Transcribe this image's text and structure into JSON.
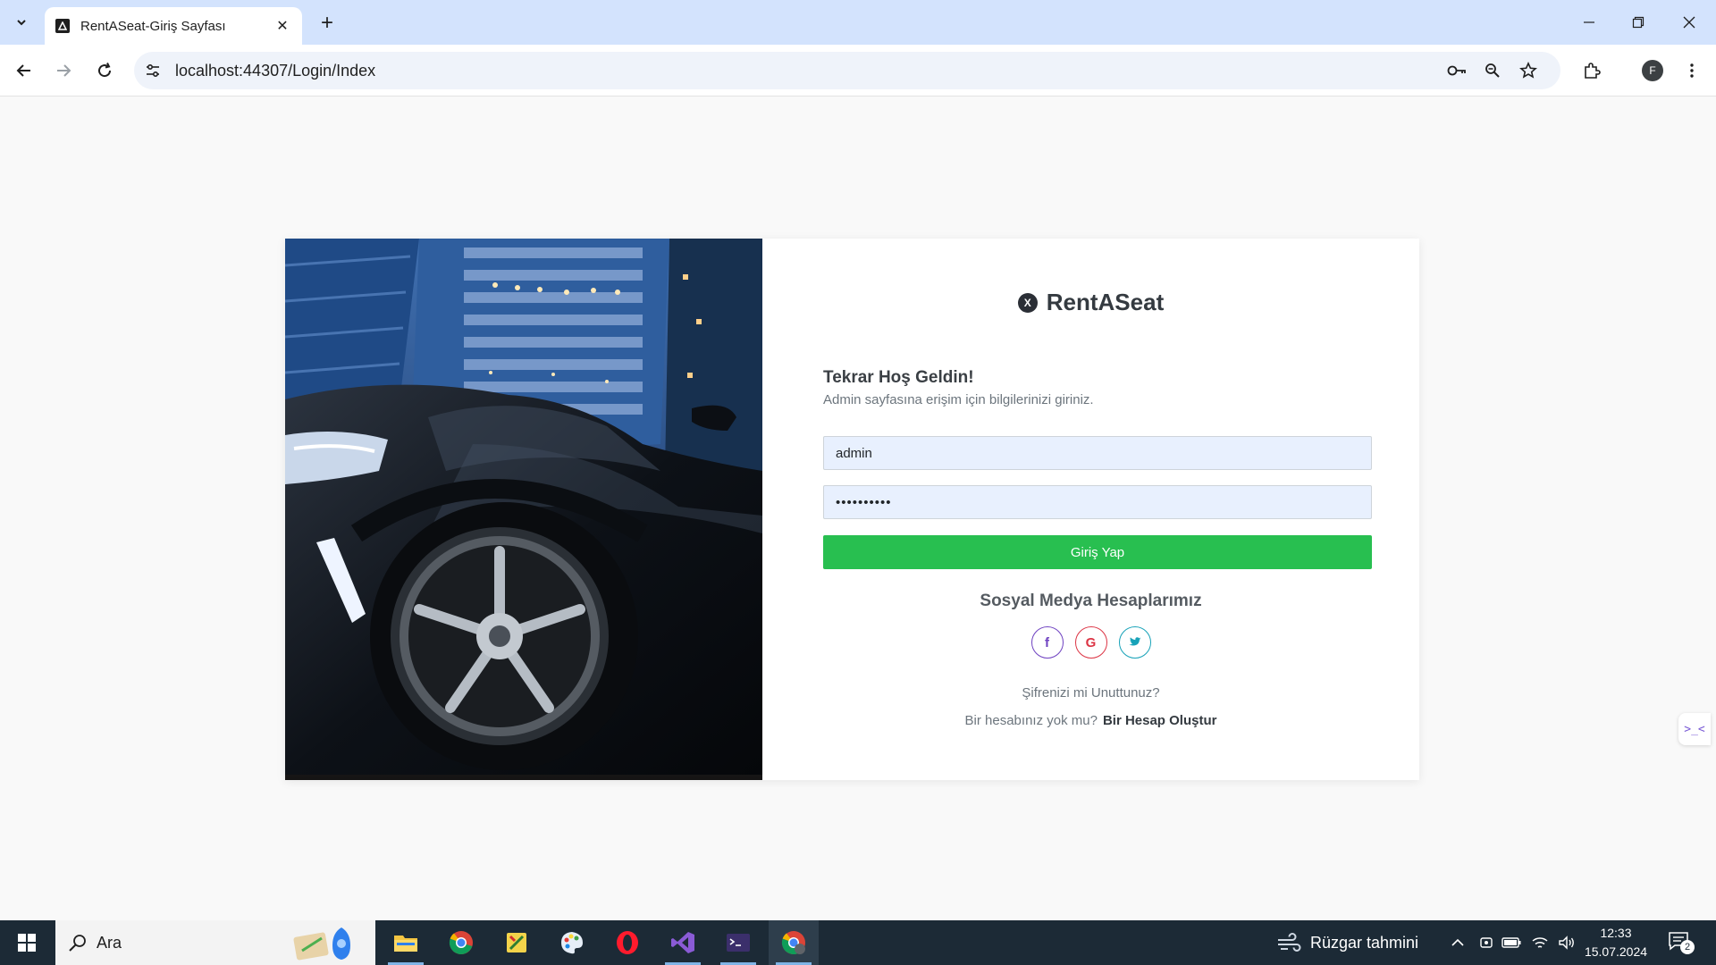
{
  "browser": {
    "tab_title": "RentASeat-Giriş Sayfası",
    "url": "localhost:44307/Login/Index",
    "profile_initial": "F"
  },
  "login": {
    "brand_name": "RentASeat",
    "brand_logo_letter": "X",
    "welcome": "Tekrar Hoş Geldin!",
    "subtitle": "Admin sayfasına erişim için bilgilerinizi giriniz.",
    "username_value": "admin",
    "password_value": "••••••••••",
    "login_button": "Giriş Yap",
    "social_title": "Sosyal Medya Hesaplarımız",
    "social": [
      {
        "name": "facebook",
        "glyph": "f",
        "color": "#6f42c1"
      },
      {
        "name": "google",
        "glyph": "G",
        "color": "#dc3545"
      },
      {
        "name": "twitter",
        "glyph": "t",
        "color": "#17a2b8"
      }
    ],
    "forgot_password": "Şifrenizi mi Unuttunuz?",
    "no_account": "Bir hesabınız yok mu?",
    "create_account": "Bir Hesap Oluştur",
    "accent_color": "#28bf50"
  },
  "taskbar": {
    "search_label": "Ara",
    "weather_label": "Rüzgar tahmini",
    "time": "12:33",
    "date": "15.07.2024",
    "notification_count": "2"
  }
}
